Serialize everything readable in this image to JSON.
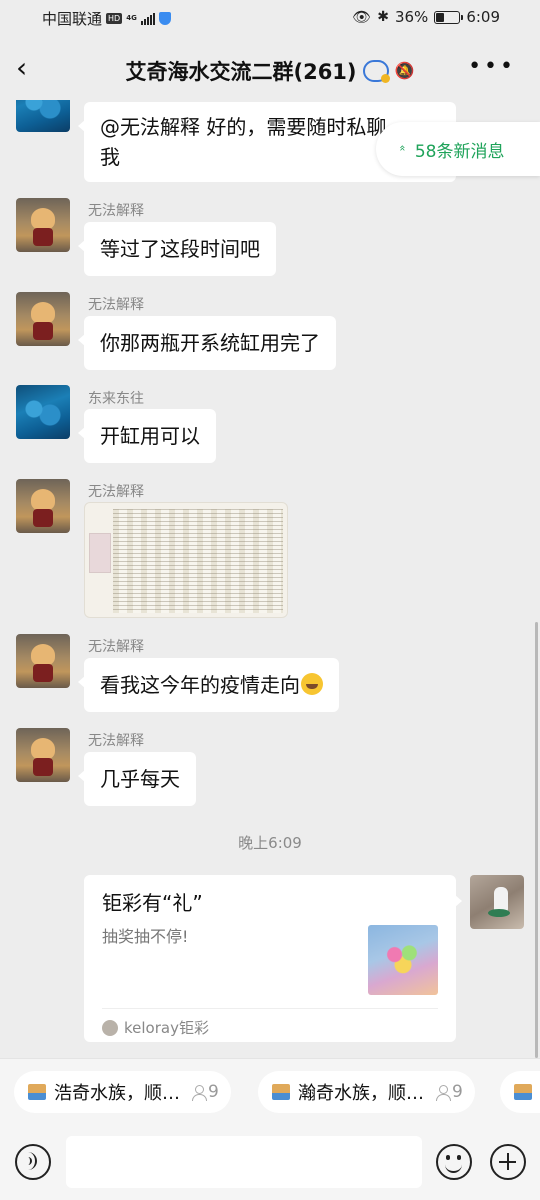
{
  "status_bar": {
    "carrier": "中国联通",
    "hd": "HD",
    "network": "4G",
    "battery": "36%",
    "battery_level": 0.36,
    "time": "6:09"
  },
  "header": {
    "title": "艾奇海水交流二群(261)"
  },
  "new_messages": "58条新消息",
  "messages": [
    {
      "text_line1": "@无法解释  好的，需要随时私聊",
      "text_line2": "我"
    },
    {
      "sender": "无法解释",
      "text": "等过了这段时间吧"
    },
    {
      "sender": "无法解释",
      "text": "你那两瓶开系统缸用完了"
    },
    {
      "sender": "东来东往",
      "text": "开缸用可以"
    },
    {
      "sender": "无法解释"
    },
    {
      "sender": "无法解释",
      "text": "看我这今年的疫情走向"
    },
    {
      "sender": "无法解释",
      "text": "几乎每天"
    }
  ],
  "timestamp": "晚上6:09",
  "card": {
    "title": "钜彩有“礼”",
    "description": "抽奖抽不停!",
    "source": "keloray钜彩"
  },
  "quick_groups": [
    {
      "name": "浩奇水族，顺…",
      "count": "9"
    },
    {
      "name": "瀚奇水族，顺…",
      "count": "9"
    }
  ]
}
